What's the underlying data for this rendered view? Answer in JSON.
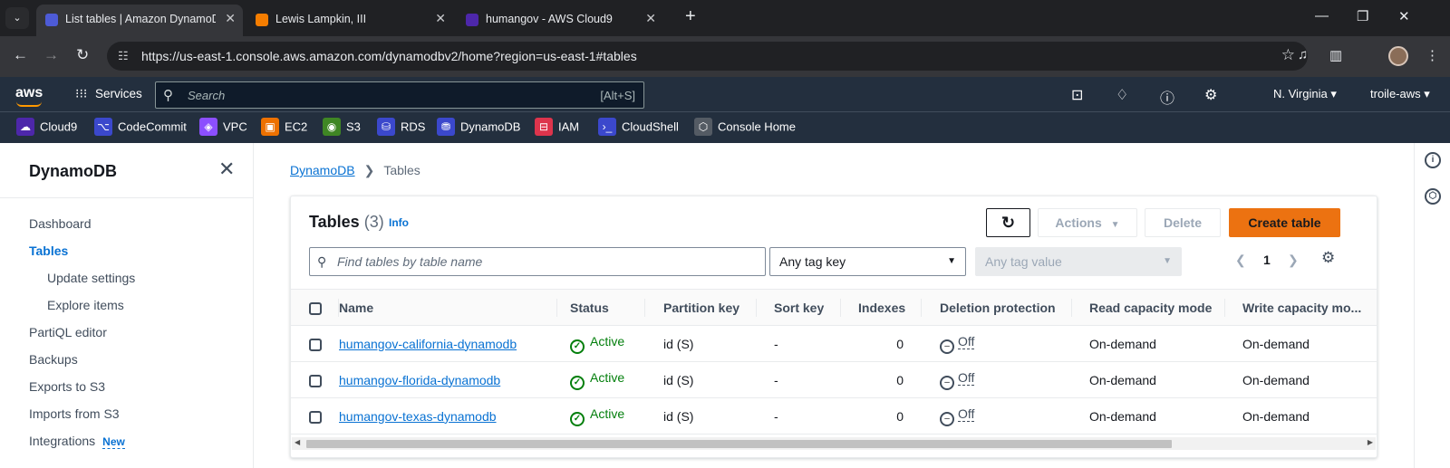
{
  "browser": {
    "tabs": [
      {
        "title": "List tables | Amazon DynamoDB",
        "active": true
      },
      {
        "title": "Lewis Lampkin, III",
        "active": false
      },
      {
        "title": "humangov - AWS Cloud9",
        "active": false
      }
    ],
    "url": "https://us-east-1.console.aws.amazon.com/dynamodbv2/home?region=us-east-1#tables"
  },
  "aws_header": {
    "logo": "aws",
    "services_label": "Services",
    "search_placeholder": "Search",
    "search_shortcut": "[Alt+S]",
    "region": "N. Virginia",
    "account": "troile-aws"
  },
  "favorites": [
    {
      "label": "Cloud9",
      "icon": "cloud9-icon",
      "color": "#4d27aa"
    },
    {
      "label": "CodeCommit",
      "icon": "codecommit-icon",
      "color": "#3b48cc"
    },
    {
      "label": "VPC",
      "icon": "vpc-icon",
      "color": "#8c4fff"
    },
    {
      "label": "EC2",
      "icon": "ec2-icon",
      "color": "#ed7100"
    },
    {
      "label": "S3",
      "icon": "s3-icon",
      "color": "#3f8624"
    },
    {
      "label": "RDS",
      "icon": "rds-icon",
      "color": "#3b48cc"
    },
    {
      "label": "DynamoDB",
      "icon": "dynamodb-icon",
      "color": "#3b48cc"
    },
    {
      "label": "IAM",
      "icon": "iam-icon",
      "color": "#dd344c"
    },
    {
      "label": "CloudShell",
      "icon": "cloudshell-icon",
      "color": "#3b48cc"
    },
    {
      "label": "Console Home",
      "icon": "console-home-icon",
      "color": "#545b64"
    }
  ],
  "sidebar": {
    "title": "DynamoDB",
    "items": [
      {
        "label": "Dashboard"
      },
      {
        "label": "Tables",
        "active": true
      },
      {
        "label": "Update settings",
        "sub": true
      },
      {
        "label": "Explore items",
        "sub": true
      },
      {
        "label": "PartiQL editor"
      },
      {
        "label": "Backups"
      },
      {
        "label": "Exports to S3"
      },
      {
        "label": "Imports from S3"
      },
      {
        "label": "Integrations",
        "badge": "New"
      }
    ]
  },
  "breadcrumb": {
    "root": "DynamoDB",
    "current": "Tables"
  },
  "tables_panel": {
    "title": "Tables",
    "count": "(3)",
    "info": "Info",
    "actions_label": "Actions",
    "delete_label": "Delete",
    "create_label": "Create table",
    "filter_placeholder": "Find tables by table name",
    "tag_key": "Any tag key",
    "tag_value": "Any tag value",
    "page": "1",
    "columns": [
      "Name",
      "Status",
      "Partition key",
      "Sort key",
      "Indexes",
      "Deletion protection",
      "Read capacity mode",
      "Write capacity mo..."
    ],
    "rows": [
      {
        "name": "humangov-california-dynamodb",
        "status": "Active",
        "partition_key": "id (S)",
        "sort_key": "-",
        "indexes": "0",
        "deletion_protection": "Off",
        "read_mode": "On-demand",
        "write_mode": "On-demand"
      },
      {
        "name": "humangov-florida-dynamodb",
        "status": "Active",
        "partition_key": "id (S)",
        "sort_key": "-",
        "indexes": "0",
        "deletion_protection": "Off",
        "read_mode": "On-demand",
        "write_mode": "On-demand"
      },
      {
        "name": "humangov-texas-dynamodb",
        "status": "Active",
        "partition_key": "id (S)",
        "sort_key": "-",
        "indexes": "0",
        "deletion_protection": "Off",
        "read_mode": "On-demand",
        "write_mode": "On-demand"
      }
    ]
  },
  "colors": {
    "accent": "#ec7211",
    "link": "#0972d3",
    "success": "#037f0c",
    "header_bg": "#232f3e"
  }
}
